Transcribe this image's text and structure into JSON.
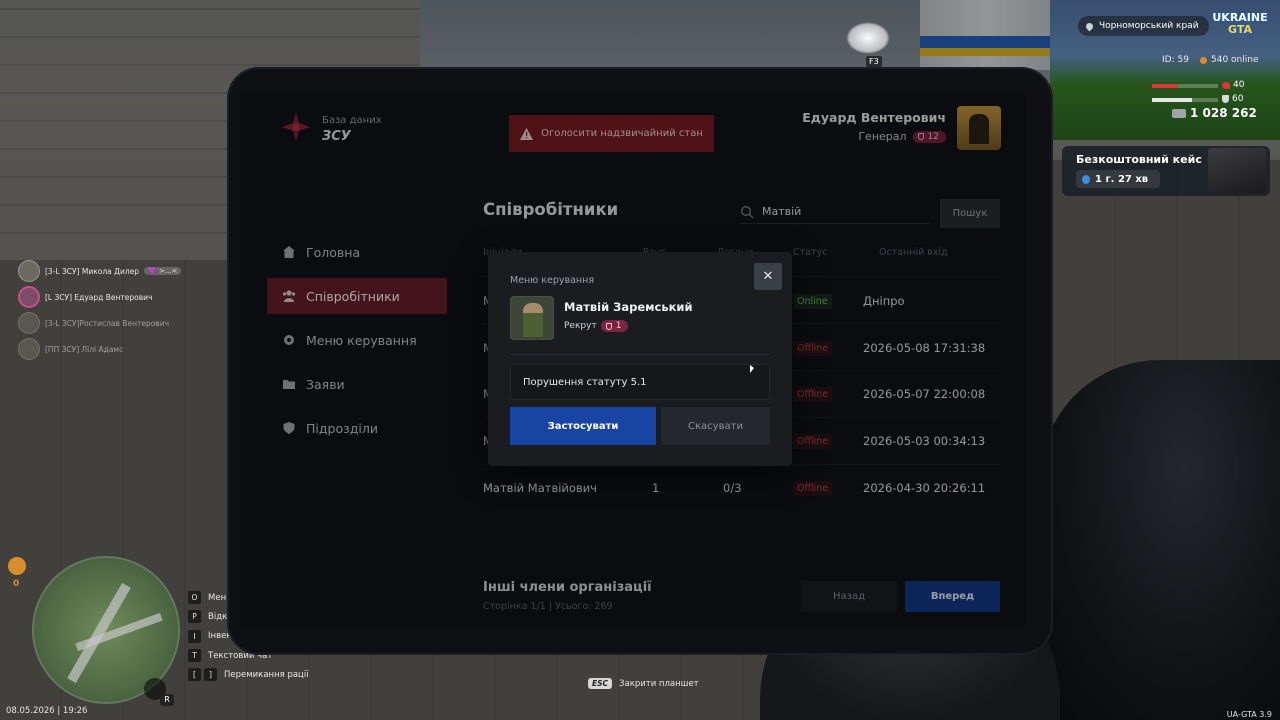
{
  "hud": {
    "region": "Чорноморський край",
    "logo_top": "UKRAINE",
    "logo_bottom": "GTA",
    "id_label": "ID: 59",
    "online": "540 online",
    "health": "40",
    "health_fraction": 0.4,
    "armor": "60",
    "armor_fraction": 0.6,
    "money": "1 028 262",
    "free_case_title": "Безкоштовний кейс",
    "free_case_timer": "1 г. 27 хв",
    "vehicle_key": "F3",
    "date_time": "08.05.2026 | 19:26",
    "version": "UA-GTA 3.9",
    "mic_key": "R",
    "minimap_counter": "0",
    "esc_key": "ESC",
    "esc_label": "Закрити планшет"
  },
  "nearby_players": [
    {
      "name": "[3-L ЗСУ] Микола Дилер",
      "tag": "💜 >...<"
    },
    {
      "name": "[L ЗСУ] Едуард Вентерович",
      "tag": ""
    },
    {
      "name": "[3-L ЗСУ]Ростислав Вентерович",
      "tag": ""
    },
    {
      "name": "[ПП ЗСУ] Лілі Адамс",
      "tag": ""
    }
  ],
  "key_hints": [
    {
      "key": "O",
      "label": "Мен"
    },
    {
      "key": "P",
      "label": "Відк"
    },
    {
      "key": "I",
      "label": "Інвент"
    },
    {
      "key": "T",
      "label": "Текстовий чат"
    },
    {
      "key": "[",
      "key2": "]",
      "label": "Перемикання рації"
    }
  ],
  "tablet": {
    "brand_small": "База даних",
    "brand_big": "ЗСУ",
    "emergency_button": "Оголосити надзвичайний стан",
    "user": {
      "name": "Едуард Вентерович",
      "rank": "Генерал",
      "rank_level": "12"
    },
    "nav": [
      {
        "label": "Головна",
        "icon": "home-icon"
      },
      {
        "label": "Співробітники",
        "icon": "users-icon"
      },
      {
        "label": "Меню керування",
        "icon": "gear-icon"
      },
      {
        "label": "Заяви",
        "icon": "folder-icon"
      },
      {
        "label": "Підрозділи",
        "icon": "badge-icon"
      }
    ],
    "section_title": "Співробітники",
    "search_value": "Матвій",
    "search_button": "Пошук",
    "columns": [
      "Ініціали",
      "Ранг",
      "Догани",
      "Статус",
      "Останній вхід"
    ],
    "rows": [
      {
        "name": "М",
        "rank": "",
        "warns": "",
        "status": "Online",
        "last": "Дніпро"
      },
      {
        "name": "М",
        "rank": "",
        "warns": "",
        "status": "Offline",
        "last": "2026-05-08 17:31:38"
      },
      {
        "name": "М",
        "rank": "",
        "warns": "",
        "status": "Offline",
        "last": "2026-05-07 22:00:08"
      },
      {
        "name": "М",
        "rank": "",
        "warns": "",
        "status": "Offline",
        "last": "2026-05-03 00:34:13"
      },
      {
        "name": "Матвій Матвійович",
        "rank": "1",
        "warns": "0/3",
        "status": "Offline",
        "last": "2026-04-30 20:26:11"
      }
    ],
    "others_title": "Інші члени організації",
    "others_sub": "Сторінка 1/1 | Усього: 269",
    "back_button": "Назад",
    "next_button": "Вперед"
  },
  "modal": {
    "title": "Меню керування",
    "close": "✕",
    "member_name": "Матвій Заремський",
    "member_rank": "Рекрут",
    "member_rank_level": "1",
    "reason_value": "Порушення статуту 5.1",
    "apply_button": "Застосувати",
    "cancel_button": "Скасувати"
  }
}
